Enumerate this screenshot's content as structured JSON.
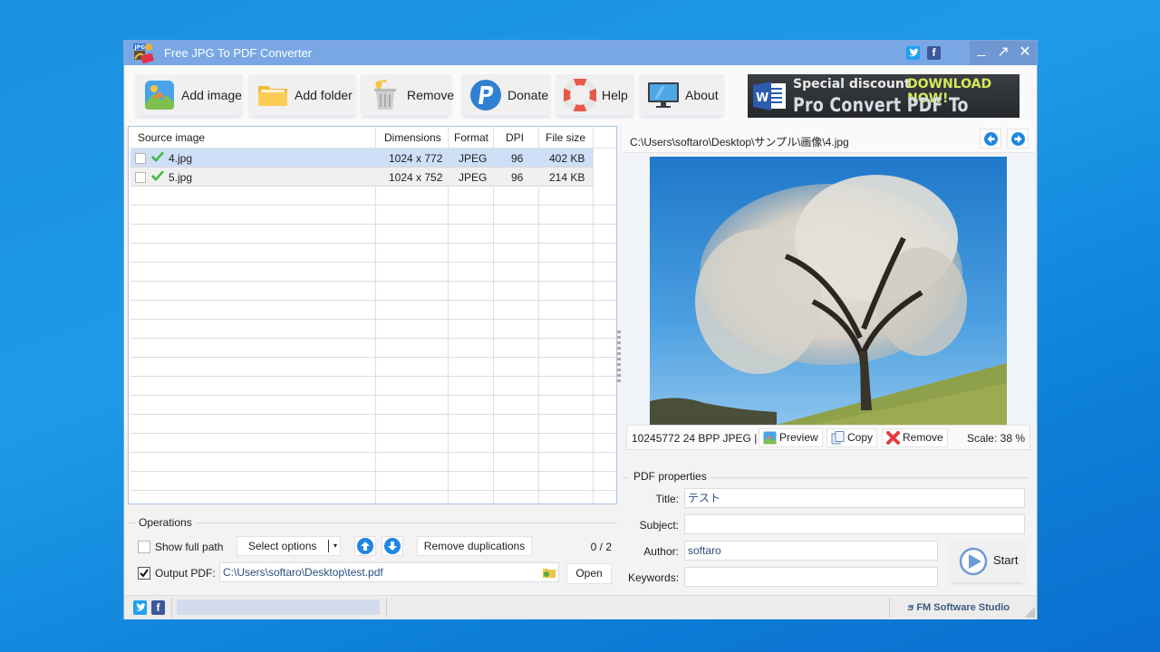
{
  "window": {
    "title": "Free JPG To PDF Converter",
    "controls": {
      "minimize": "_",
      "maximize": "↗",
      "close": "✕"
    },
    "social": {
      "twitter": "t",
      "facebook": "f"
    }
  },
  "toolbar": {
    "buttons": [
      {
        "id": "add-image",
        "label": "Add image",
        "icon": "add-image-icon"
      },
      {
        "id": "add-folder",
        "label": "Add folder",
        "icon": "folder-icon"
      },
      {
        "id": "remove",
        "label": "Remove",
        "icon": "trash-icon"
      },
      {
        "id": "donate",
        "label": "Donate",
        "icon": "paypal-icon"
      },
      {
        "id": "help",
        "label": "Help",
        "icon": "lifebuoy-icon"
      },
      {
        "id": "about",
        "label": "About",
        "icon": "monitor-icon"
      }
    ],
    "banner": {
      "line1": "Special discount",
      "line1_highlight": "DOWNLOAD NOW!",
      "line2": "Pro Convert PDF To Word",
      "icon_letter": "W"
    }
  },
  "file_list": {
    "columns": [
      "Source image",
      "Dimensions",
      "Format",
      "DPI",
      "File size"
    ],
    "rows": [
      {
        "name": "4.jpg",
        "dimensions": "1024 x 772",
        "format": "JPEG",
        "dpi": "96",
        "size": "402 KB",
        "checked": false,
        "status": "ok",
        "selected": true
      },
      {
        "name": "5.jpg",
        "dimensions": "1024 x 752",
        "format": "JPEG",
        "dpi": "96",
        "size": "214 KB",
        "checked": false,
        "status": "ok",
        "selected": false
      }
    ]
  },
  "operations": {
    "group_label": "Operations",
    "show_full_path_label": "Show full path",
    "show_full_path_checked": false,
    "select_options_label": "Select options",
    "move_up_icon": "arrow-up-icon",
    "move_down_icon": "arrow-down-icon",
    "remove_duplications_label": "Remove duplications",
    "counter": "0 / 2",
    "output_pdf_label": "Output PDF:",
    "output_pdf_checked": true,
    "output_pdf_path": "C:\\Users\\softaro\\Desktop\\test.pdf",
    "open_label": "Open"
  },
  "preview": {
    "path": "C:\\Users\\softaro\\Desktop\\サンプル\\画像\\4.jpg",
    "info": "10245772  24 BPP  JPEG  |",
    "preview_label": "Preview",
    "copy_label": "Copy",
    "remove_label": "Remove",
    "scale": "Scale: 38 %"
  },
  "pdf_properties": {
    "group_label": "PDF properties",
    "title_label": "Title:",
    "title_value": "テスト",
    "subject_label": "Subject:",
    "subject_value": "",
    "author_label": "Author:",
    "author_value": "softaro",
    "keywords_label": "Keywords:",
    "keywords_value": "",
    "start_label": "Start"
  },
  "statusbar": {
    "progress": 0,
    "studio": "FM Software Studio"
  },
  "colors": {
    "titlebar": "#79a7e6",
    "accent_blue": "#1f86e0",
    "selected_row": "#cfdff7",
    "ok_green": "#3cb83c",
    "remove_red": "#e23b3b"
  }
}
